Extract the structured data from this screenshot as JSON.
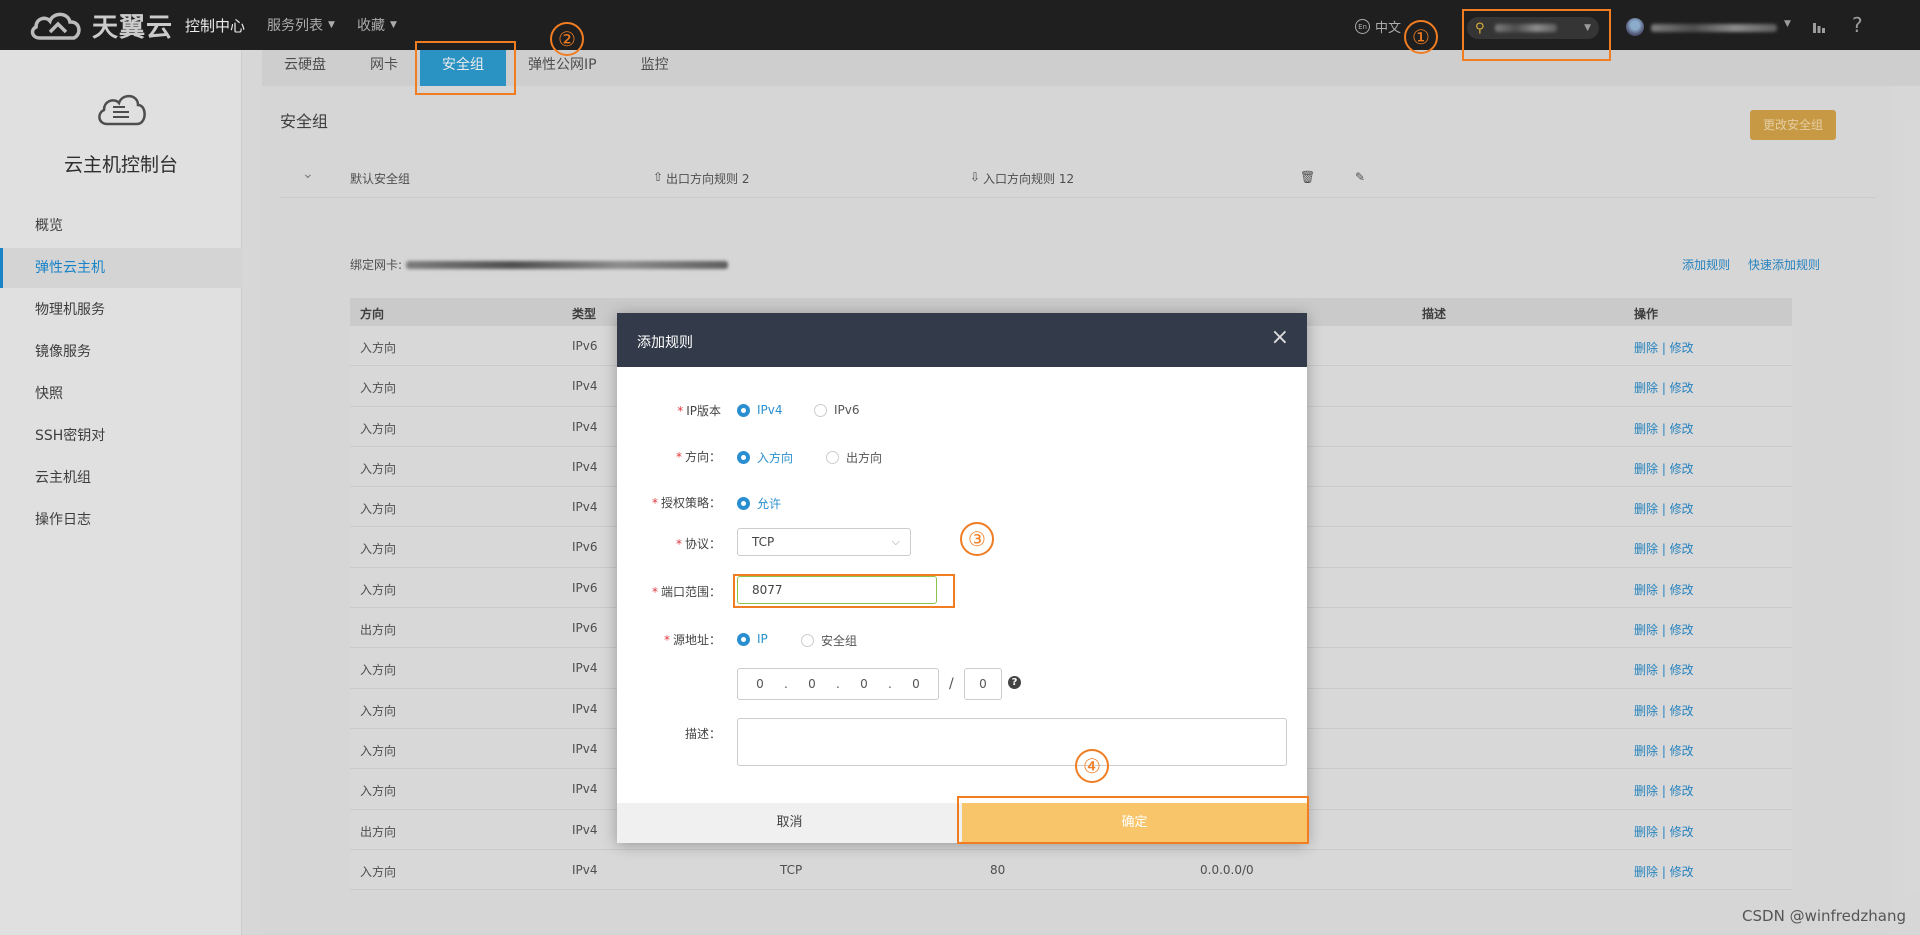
{
  "topbar": {
    "brand": "天翼云",
    "console": "控制中心",
    "menus": [
      "服务列表",
      "收藏"
    ],
    "lang_icon": "En",
    "lang": "中文",
    "help": "?"
  },
  "sidebar": {
    "title": "云主机控制台",
    "items": [
      "概览",
      "弹性云主机",
      "物理机服务",
      "镜像服务",
      "快照",
      "SSH密钥对",
      "云主机组",
      "操作日志"
    ],
    "active_index": 1
  },
  "tabs": [
    "云硬盘",
    "网卡",
    "安全组",
    "弹性公网IP",
    "监控"
  ],
  "security_group": {
    "title": "安全组",
    "change_button": "更改安全组",
    "group_name": "默认安全组",
    "outbound": "出口方向规则 2",
    "inbound": "入口方向规则 12",
    "bind_label": "绑定网卡:",
    "add_rule": "添加规则",
    "quick_add": "快速添加规则"
  },
  "table": {
    "headers": [
      "方向",
      "类型",
      "",
      "",
      "",
      "描述",
      "操作"
    ],
    "rows": [
      {
        "direction": "入方向",
        "type": "IPv6"
      },
      {
        "direction": "入方向",
        "type": "IPv4"
      },
      {
        "direction": "入方向",
        "type": "IPv4"
      },
      {
        "direction": "入方向",
        "type": "IPv4"
      },
      {
        "direction": "入方向",
        "type": "IPv4"
      },
      {
        "direction": "入方向",
        "type": "IPv6"
      },
      {
        "direction": "入方向",
        "type": "IPv6"
      },
      {
        "direction": "出方向",
        "type": "IPv6"
      },
      {
        "direction": "入方向",
        "type": "IPv4"
      },
      {
        "direction": "入方向",
        "type": "IPv4"
      },
      {
        "direction": "入方向",
        "type": "IPv4"
      },
      {
        "direction": "入方向",
        "type": "IPv4"
      },
      {
        "direction": "出方向",
        "type": "IPv4"
      },
      {
        "direction": "入方向",
        "type": "IPv4",
        "protocol": "TCP",
        "port": "80",
        "source": "0.0.0.0/0"
      }
    ],
    "ops": "删除 | 修改"
  },
  "dialog": {
    "title": "添加规则",
    "close": "×",
    "ip_version_label": "IP版本",
    "ip_options": [
      "IPv4",
      "IPv6"
    ],
    "direction_label": "方向：",
    "direction_options": [
      "入方向",
      "出方向"
    ],
    "policy_label": "授权策略：",
    "policy_option": "允许",
    "protocol_label": "协议：",
    "protocol_value": "TCP",
    "port_label": "端口范围：",
    "port_value": "8077",
    "source_label": "源地址：",
    "source_options": [
      "IP",
      "安全组"
    ],
    "ip_parts": [
      "0",
      ".",
      "0",
      ".",
      "0",
      ".",
      "0"
    ],
    "slash": "/",
    "mask_value": "0",
    "help_mark": "?",
    "desc_label": "描述：",
    "cancel": "取消",
    "ok": "确定"
  },
  "annotations": [
    "①",
    "②",
    "③",
    "④"
  ],
  "watermark": "CSDN @winfredzhang",
  "colors": {
    "accent": "#2fa0d4",
    "highlight": "#f07d22",
    "ok_button": "#f8c56b"
  }
}
